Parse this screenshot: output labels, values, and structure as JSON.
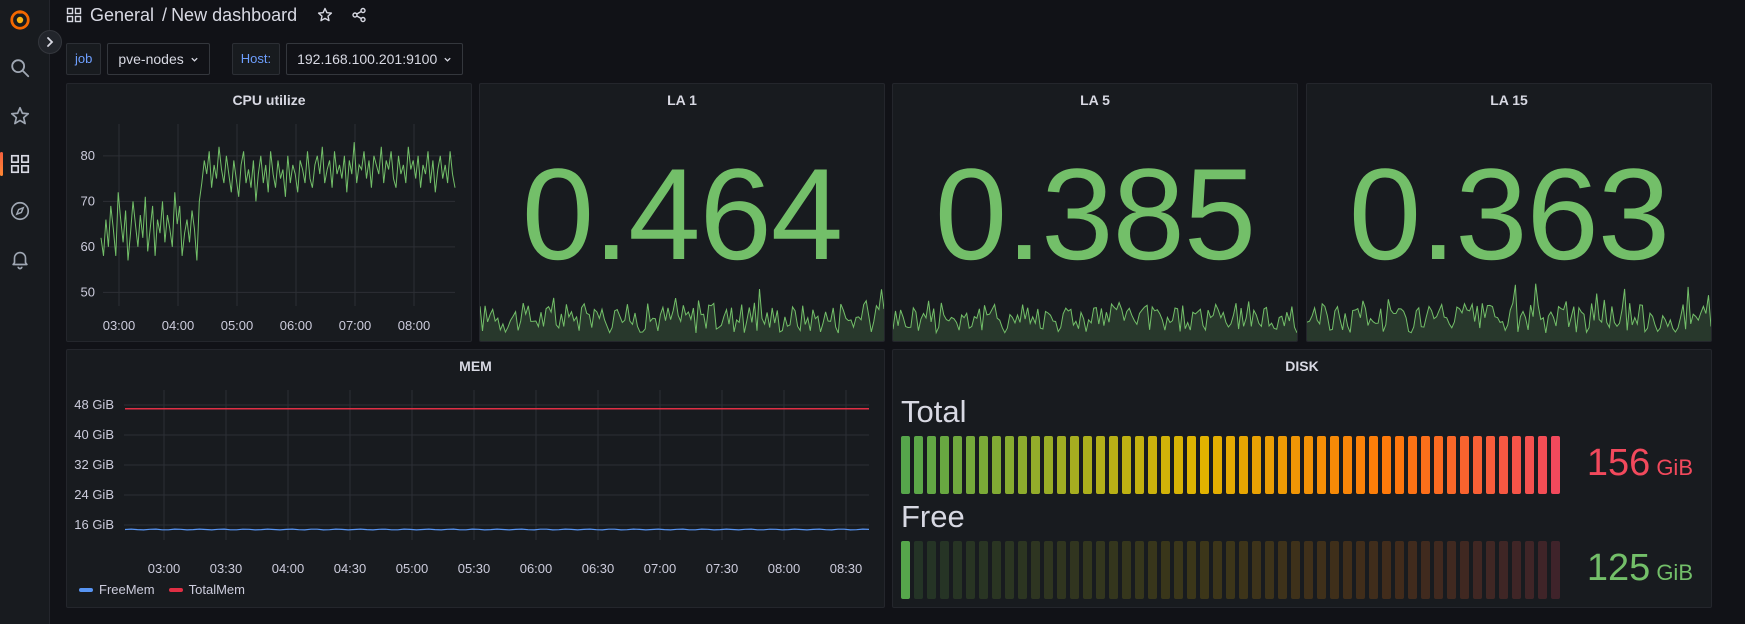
{
  "header": {
    "folder": "General",
    "separator": "/",
    "title": "New dashboard"
  },
  "variables": [
    {
      "label": "job",
      "value": "pve-nodes"
    },
    {
      "label": "Host:",
      "value": "192.168.100.201:9100"
    }
  ],
  "colors": {
    "green": "#73bf69",
    "red": "#f2495c",
    "blue": "#5794f2",
    "total_line": "#e02f44"
  },
  "panels": {
    "cpu": {
      "title": "CPU utilize",
      "chart_data": {
        "type": "line",
        "x_ticks": [
          "03:00",
          "04:00",
          "05:00",
          "06:00",
          "07:00",
          "08:00"
        ],
        "y_ticks": [
          50,
          60,
          70,
          80
        ],
        "ylim": [
          47,
          87
        ],
        "series": [
          {
            "values": [
              62,
              58,
              66,
              60,
              69,
              64,
              58,
              72,
              66,
              61,
              68,
              57,
              63,
              70,
              65,
              60,
              67,
              62,
              71,
              59,
              64,
              69,
              58,
              66,
              63,
              70,
              61,
              67,
              64,
              60,
              72,
              65,
              69,
              58,
              63,
              66,
              61,
              68,
              64,
              57,
              70,
              74,
              79,
              76,
              81,
              73,
              78,
              75,
              82,
              77,
              74,
              80,
              76,
              72,
              79,
              75,
              71,
              78,
              81,
              74,
              77,
              73,
              79,
              70,
              76,
              80,
              74,
              78,
              72,
              81,
              76,
              73,
              79,
              75,
              77,
              71,
              80,
              74,
              78,
              76,
              72,
              79,
              77,
              74,
              81,
              75,
              73,
              78,
              80,
              76,
              82,
              74,
              77,
              79,
              73,
              81,
              76,
              78,
              75,
              80,
              72,
              79,
              76,
              83,
              74,
              78,
              77,
              81,
              75,
              79,
              73,
              80,
              78,
              76,
              82,
              74,
              79,
              77,
              81,
              75,
              73,
              80,
              76,
              78,
              74,
              82,
              77,
              79,
              75,
              80,
              73,
              78,
              76,
              81,
              74,
              79,
              72,
              77,
              80,
              75,
              78,
              74,
              81,
              76,
              73
            ]
          }
        ]
      }
    },
    "la1": {
      "title": "LA 1",
      "value": "0.464"
    },
    "la5": {
      "title": "LA 5",
      "value": "0.385"
    },
    "la15": {
      "title": "LA 15",
      "value": "0.363"
    },
    "mem": {
      "title": "MEM",
      "chart_data": {
        "type": "line",
        "x_ticks": [
          "03:00",
          "03:30",
          "04:00",
          "04:30",
          "05:00",
          "05:30",
          "06:00",
          "06:30",
          "07:00",
          "07:30",
          "08:00",
          "08:30"
        ],
        "y_ticks": [
          "16 GiB",
          "24 GiB",
          "32 GiB",
          "40 GiB",
          "48 GiB"
        ],
        "y_values": [
          16,
          24,
          32,
          40,
          48
        ],
        "ylim": [
          12,
          52
        ],
        "series": [
          {
            "name": "FreeMem",
            "value": 14.8
          },
          {
            "name": "TotalMem",
            "value": 47
          }
        ]
      }
    },
    "disk": {
      "title": "DISK",
      "gauges": [
        {
          "name": "Total",
          "value": "156",
          "unit": "GiB",
          "fill": 1.0
        },
        {
          "name": "Free",
          "value": "125",
          "unit": "GiB",
          "fill": 0.02
        }
      ]
    }
  }
}
